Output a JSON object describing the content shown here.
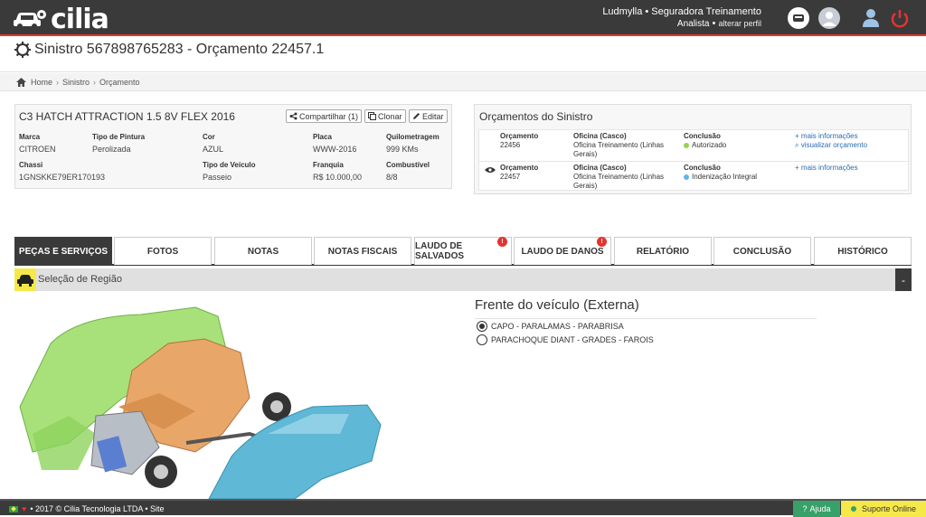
{
  "header": {
    "logo_text": "cilia",
    "user_line": "Ludmylla • Seguradora Treinamento",
    "role": "Analista",
    "change_profile": "alterar perfil",
    "colors": {
      "bar": "#3a3a3a",
      "accent": "#e3342f"
    }
  },
  "page": {
    "title": "Sinistro 567898765283 - Orçamento 22457.1"
  },
  "breadcrumb": {
    "items": [
      "Home",
      "Sinistro",
      "Orçamento"
    ]
  },
  "vehicle": {
    "title": "C3 HATCH ATTRACTION 1.5 8V FLEX 2016",
    "share_label": "Compartilhar (1)",
    "clone_label": "Clonar",
    "edit_label": "Editar",
    "fields": {
      "marca": {
        "label": "Marca",
        "value": "CITROEN"
      },
      "pintura": {
        "label": "Tipo de Pintura",
        "value": "Perolizada"
      },
      "cor": {
        "label": "Cor",
        "value": "AZUL"
      },
      "placa": {
        "label": "Placa",
        "value": "WWW-2016"
      },
      "km": {
        "label": "Quilometragem",
        "value": "999 KMs"
      },
      "chassi": {
        "label": "Chassi",
        "value": "1GNSKKE79ER170193"
      },
      "tipo": {
        "label": "Tipo de Veículo",
        "value": "Passeio"
      },
      "franquia": {
        "label": "Franquia",
        "value": "R$ 10.000,00"
      },
      "combustivel": {
        "label": "Combustível",
        "value": "8/8"
      }
    }
  },
  "orcamentos": {
    "title": "Orçamentos do Sinistro",
    "rows": [
      {
        "orc_label": "Orçamento",
        "orc_num": "22456",
        "oficina_label": "Oficina (Casco)",
        "oficina_value": "Oficina Treinamento (Linhas Gerais)",
        "conclusao_label": "Conclusão",
        "conclusao_value": "Autorizado",
        "status_color": "#9ad14b",
        "link1": "mais informações",
        "link2": "visualizar orçamento"
      },
      {
        "orc_label": "Orçamento",
        "orc_num": "22457",
        "oficina_label": "Oficina (Casco)",
        "oficina_value": "Oficina Treinamento (Linhas Gerais)",
        "conclusao_label": "Conclusão",
        "conclusao_value": "Indenização Integral",
        "status_color": "#63b3ed",
        "link1": "mais informações"
      }
    ]
  },
  "tabs": [
    {
      "label": "PEÇAS E SERVIÇOS",
      "active": true
    },
    {
      "label": "FOTOS"
    },
    {
      "label": "NOTAS"
    },
    {
      "label": "NOTAS FISCAIS"
    },
    {
      "label": "LAUDO DE SALVADOS",
      "badge": "!"
    },
    {
      "label": "LAUDO DE DANOS",
      "badge": "!"
    },
    {
      "label": "RELATÓRIO"
    },
    {
      "label": "CONCLUSÃO"
    },
    {
      "label": "HISTÓRICO"
    }
  ],
  "region": {
    "bar_title": "Seleção de Região",
    "collapse_label": "-",
    "section_title": "Frente do veículo (Externa)",
    "options": [
      {
        "label": "CAPO - PARALAMAS - PARABRISA",
        "selected": true
      },
      {
        "label": "PARACHOQUE DIANT - GRADES - FAROIS",
        "selected": false
      }
    ]
  },
  "footer": {
    "text": "• 2017 © Cilia Tecnologia LTDA • Site",
    "help_label": "Ajuda",
    "support_label": "Suporte Online"
  }
}
